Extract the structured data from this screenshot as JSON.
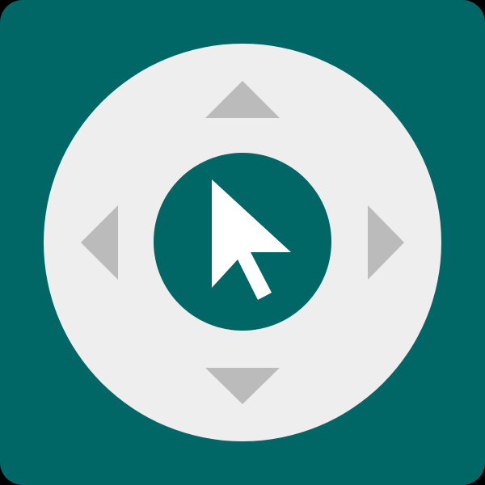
{
  "icon": {
    "background_color": "#006766",
    "dpad_color": "#EEEEEE",
    "arrow_color": "#BBBBBB",
    "center_button_color": "#006766",
    "cursor_color": "#FFFFFF",
    "icons": [
      "dpad-icon",
      "arrow-up-icon",
      "arrow-down-icon",
      "arrow-left-icon",
      "arrow-right-icon",
      "center-select-button",
      "mouse-pointer-icon"
    ]
  }
}
